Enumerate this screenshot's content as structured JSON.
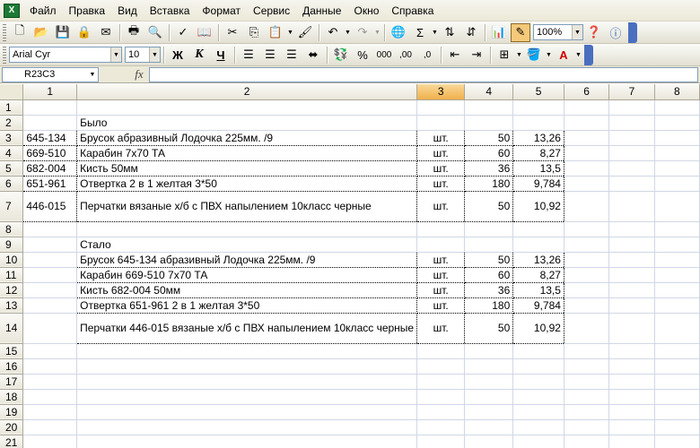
{
  "app": {
    "icon_label": "X"
  },
  "menu": [
    "Файл",
    "Правка",
    "Вид",
    "Вставка",
    "Формат",
    "Сервис",
    "Данные",
    "Окно",
    "Справка"
  ],
  "toolbar1": {
    "zoom": "100%",
    "autosum": "Σ"
  },
  "toolbar2": {
    "font_name": "Arial Cyr",
    "font_size": "10",
    "bold": "Ж",
    "italic": "К",
    "underline": "Ч",
    "percent": "%",
    "thousands": "000",
    "inc_dec": ",00",
    "dec_dec": ",0"
  },
  "formula_bar": {
    "name_box": "R23C3",
    "fx": "fx",
    "formula": ""
  },
  "columns": [
    "1",
    "2",
    "3",
    "4",
    "5",
    "6",
    "7",
    "8"
  ],
  "selected_column": "3",
  "rows": [
    {
      "n": "1",
      "c1": "",
      "c2": "",
      "c3": "",
      "c4": "",
      "c5": ""
    },
    {
      "n": "2",
      "c1": "",
      "c2": "Было",
      "c3": "",
      "c4": "",
      "c5": ""
    },
    {
      "n": "3",
      "c1": "645-134",
      "c2": "Брусок абразивный Лодочка 225мм. /9",
      "c3": "шт.",
      "c4": "50",
      "c5": "13,26"
    },
    {
      "n": "4",
      "c1": "669-510",
      "c2": "Карабин 7х70 ТА",
      "c3": "шт.",
      "c4": "60",
      "c5": "8,27"
    },
    {
      "n": "5",
      "c1": "682-004",
      "c2": "Кисть 50мм",
      "c3": "шт.",
      "c4": "36",
      "c5": "13,5"
    },
    {
      "n": "6",
      "c1": "651-961",
      "c2": "Отвертка 2 в 1 желтая 3*50",
      "c3": "шт.",
      "c4": "180",
      "c5": "9,784"
    },
    {
      "n": "7",
      "c1": "446-015",
      "c2": "Перчатки вязаные х/б с ПВХ напылением 10класс черные",
      "c3": "шт.",
      "c4": "50",
      "c5": "10,92"
    },
    {
      "n": "8",
      "c1": "",
      "c2": "",
      "c3": "",
      "c4": "",
      "c5": ""
    },
    {
      "n": "9",
      "c1": "",
      "c2": "Стало",
      "c3": "",
      "c4": "",
      "c5": ""
    },
    {
      "n": "10",
      "c1": "",
      "c2": "Брусок 645-134 абразивный Лодочка 225мм. /9",
      "c3": "шт.",
      "c4": "50",
      "c5": "13,26"
    },
    {
      "n": "11",
      "c1": "",
      "c2": "Карабин 669-510 7х70 ТА",
      "c3": "шт.",
      "c4": "60",
      "c5": "8,27"
    },
    {
      "n": "12",
      "c1": "",
      "c2": "Кисть 682-004 50мм",
      "c3": "шт.",
      "c4": "36",
      "c5": "13,5"
    },
    {
      "n": "13",
      "c1": "",
      "c2": "Отвертка 651-961 2 в 1 желтая 3*50",
      "c3": "шт.",
      "c4": "180",
      "c5": "9,784"
    },
    {
      "n": "14",
      "c1": "",
      "c2": "Перчатки 446-015 вязаные х/б с ПВХ напылением 10класс черные",
      "c3": "шт.",
      "c4": "50",
      "c5": "10,92"
    },
    {
      "n": "15"
    },
    {
      "n": "16"
    },
    {
      "n": "17"
    },
    {
      "n": "18"
    },
    {
      "n": "19"
    },
    {
      "n": "20"
    },
    {
      "n": "21"
    }
  ]
}
